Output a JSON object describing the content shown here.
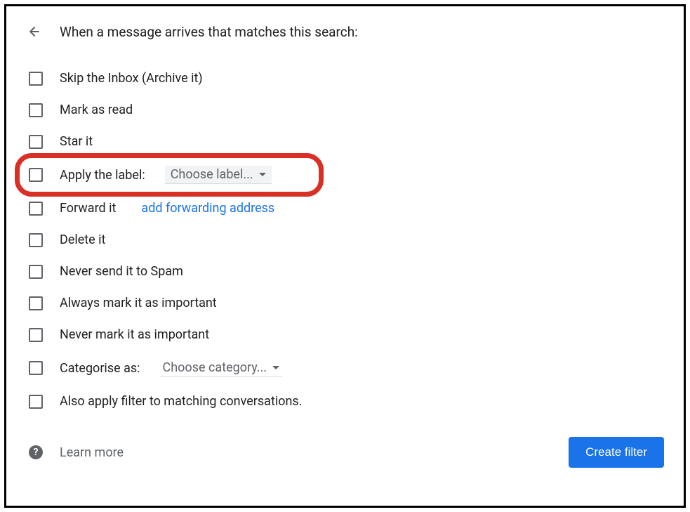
{
  "header": {
    "title": "When a message arrives that matches this search:"
  },
  "options": {
    "skip_inbox": "Skip the Inbox (Archive it)",
    "mark_read": "Mark as read",
    "star_it": "Star it",
    "apply_label": "Apply the label:",
    "apply_label_dropdown": "Choose label...",
    "forward_it": "Forward it",
    "forward_link": "add forwarding address",
    "delete_it": "Delete it",
    "never_spam": "Never send it to Spam",
    "always_important": "Always mark it as important",
    "never_important": "Never mark it as important",
    "categorise": "Categorise as:",
    "categorise_dropdown": "Choose category...",
    "apply_matching": "Also apply filter to matching conversations."
  },
  "footer": {
    "learn_more": "Learn more",
    "create_button": "Create filter"
  }
}
